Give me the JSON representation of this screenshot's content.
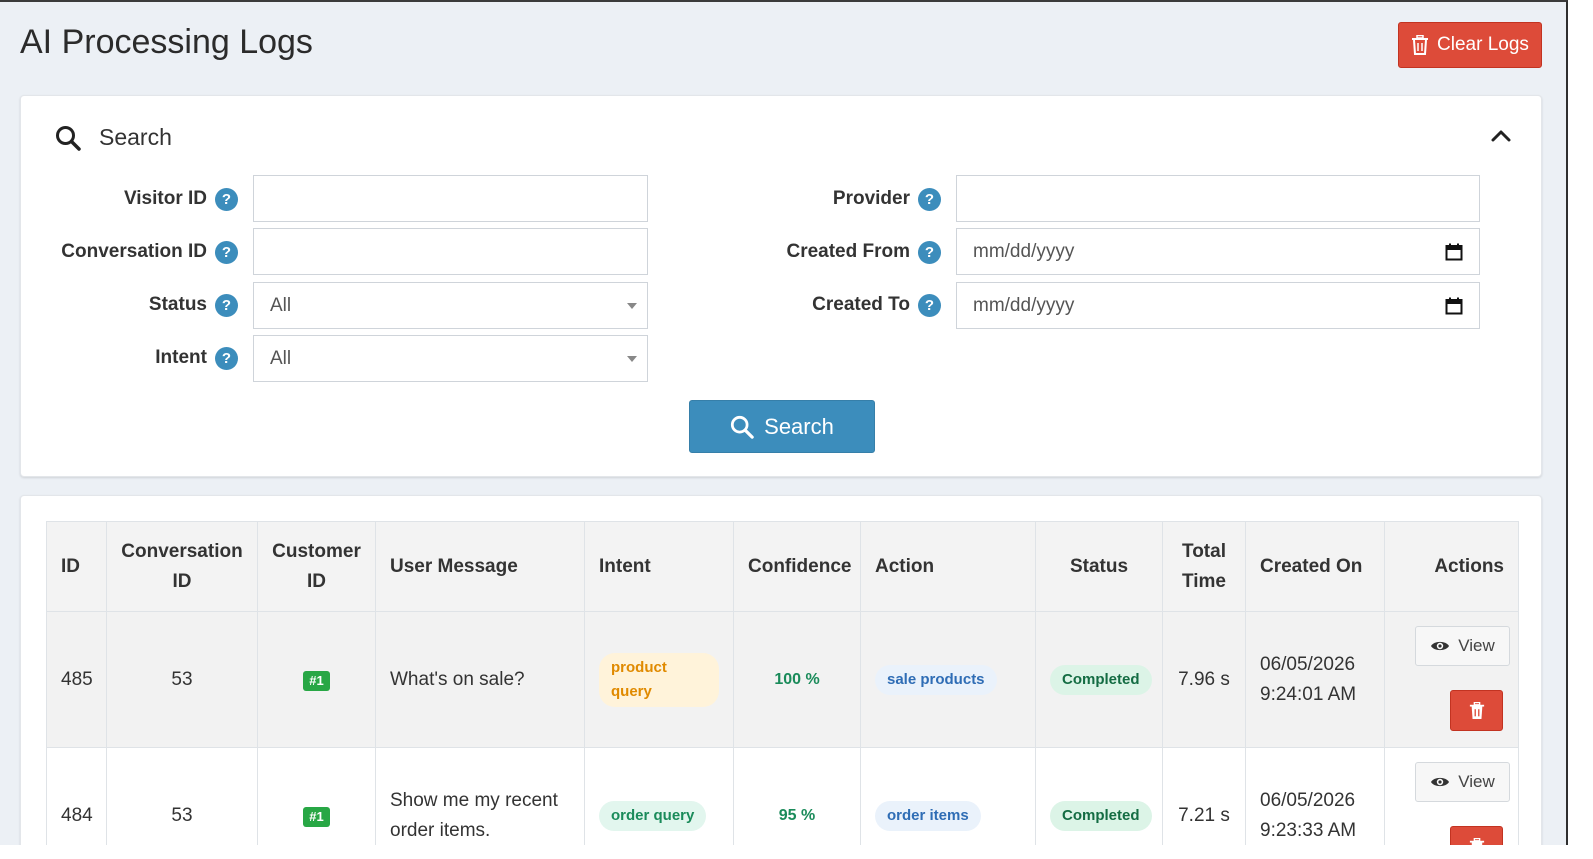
{
  "page": {
    "title": "AI Processing Logs",
    "clear_logs_label": "Clear Logs"
  },
  "search": {
    "title": "Search",
    "button_label": "Search",
    "fields": {
      "visitor_id": {
        "label": "Visitor ID",
        "value": ""
      },
      "conversation_id": {
        "label": "Conversation ID",
        "value": ""
      },
      "status": {
        "label": "Status",
        "value": "All"
      },
      "intent": {
        "label": "Intent",
        "value": "All"
      },
      "provider": {
        "label": "Provider",
        "value": ""
      },
      "created_from": {
        "label": "Created From",
        "value": "mm/dd/yyyy"
      },
      "created_to": {
        "label": "Created To",
        "value": "mm/dd/yyyy"
      }
    },
    "help_glyph": "?"
  },
  "table": {
    "headers": {
      "id": "ID",
      "conversation_id_1": "Conversation",
      "conversation_id_2": "ID",
      "customer_id_1": "Customer",
      "customer_id_2": "ID",
      "user_message": "User Message",
      "intent": "Intent",
      "confidence": "Confidence",
      "action": "Action",
      "status": "Status",
      "total_time_1": "Total",
      "total_time_2": "Time",
      "created_on": "Created On",
      "actions": "Actions"
    },
    "view_label": "View",
    "rows": [
      {
        "id": "485",
        "conversation_id": "53",
        "customer_id": "#1",
        "user_message_1": "What's on sale?",
        "user_message_2": "",
        "intent": "product query",
        "confidence": "100 %",
        "action": "sale products",
        "status": "Completed",
        "total_time": "7.96 s",
        "created_date": "06/05/2026",
        "created_time": "9:24:01 AM"
      },
      {
        "id": "484",
        "conversation_id": "53",
        "customer_id": "#1",
        "user_message_1": "Show me my recent",
        "user_message_2": "order items.",
        "intent": "order query",
        "confidence": "95 %",
        "action": "order items",
        "status": "Completed",
        "total_time": "7.21 s",
        "created_date": "06/05/2026",
        "created_time": "9:23:33 AM"
      }
    ]
  },
  "colors": {
    "danger": "#dd4b39",
    "primary": "#3c8dbc",
    "background": "#ecf0f5"
  },
  "icons": {
    "clear": "trash-icon",
    "search": "search-icon",
    "collapse": "chevron-up-icon",
    "help": "question-circle-icon",
    "calendar": "calendar-icon",
    "view": "eye-icon",
    "delete": "trash-icon"
  }
}
